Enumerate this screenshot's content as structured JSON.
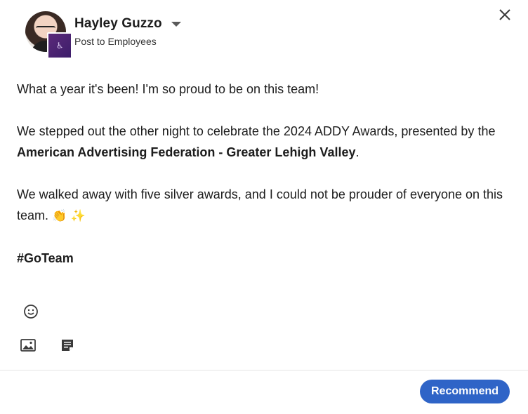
{
  "author": {
    "name": "Hayley Guzzo",
    "audience": "Post to Employees"
  },
  "post": {
    "line1": "What a year it's been! I'm so proud to be on this team!",
    "p2_before": "We stepped out the other night to celebrate the 2024 ADDY Awards, presented by the ",
    "p2_bold": "American Advertising Federation - Greater Lehigh Valley",
    "p2_after": ".",
    "p3_text": "We walked away with five silver awards, and I could not be prouder of everyone on this team.",
    "p3_emoji": "👏 ✨",
    "hashtag": "#GoTeam"
  },
  "icons": {
    "close": "close-icon",
    "emoji": "emoji-icon",
    "image": "image-icon",
    "document": "document-icon",
    "caret": "chevron-down-icon"
  },
  "footer": {
    "recommend_label": "Recommend"
  },
  "colors": {
    "primary_button": "#2f64c7",
    "org_badge": "#4a236f"
  }
}
